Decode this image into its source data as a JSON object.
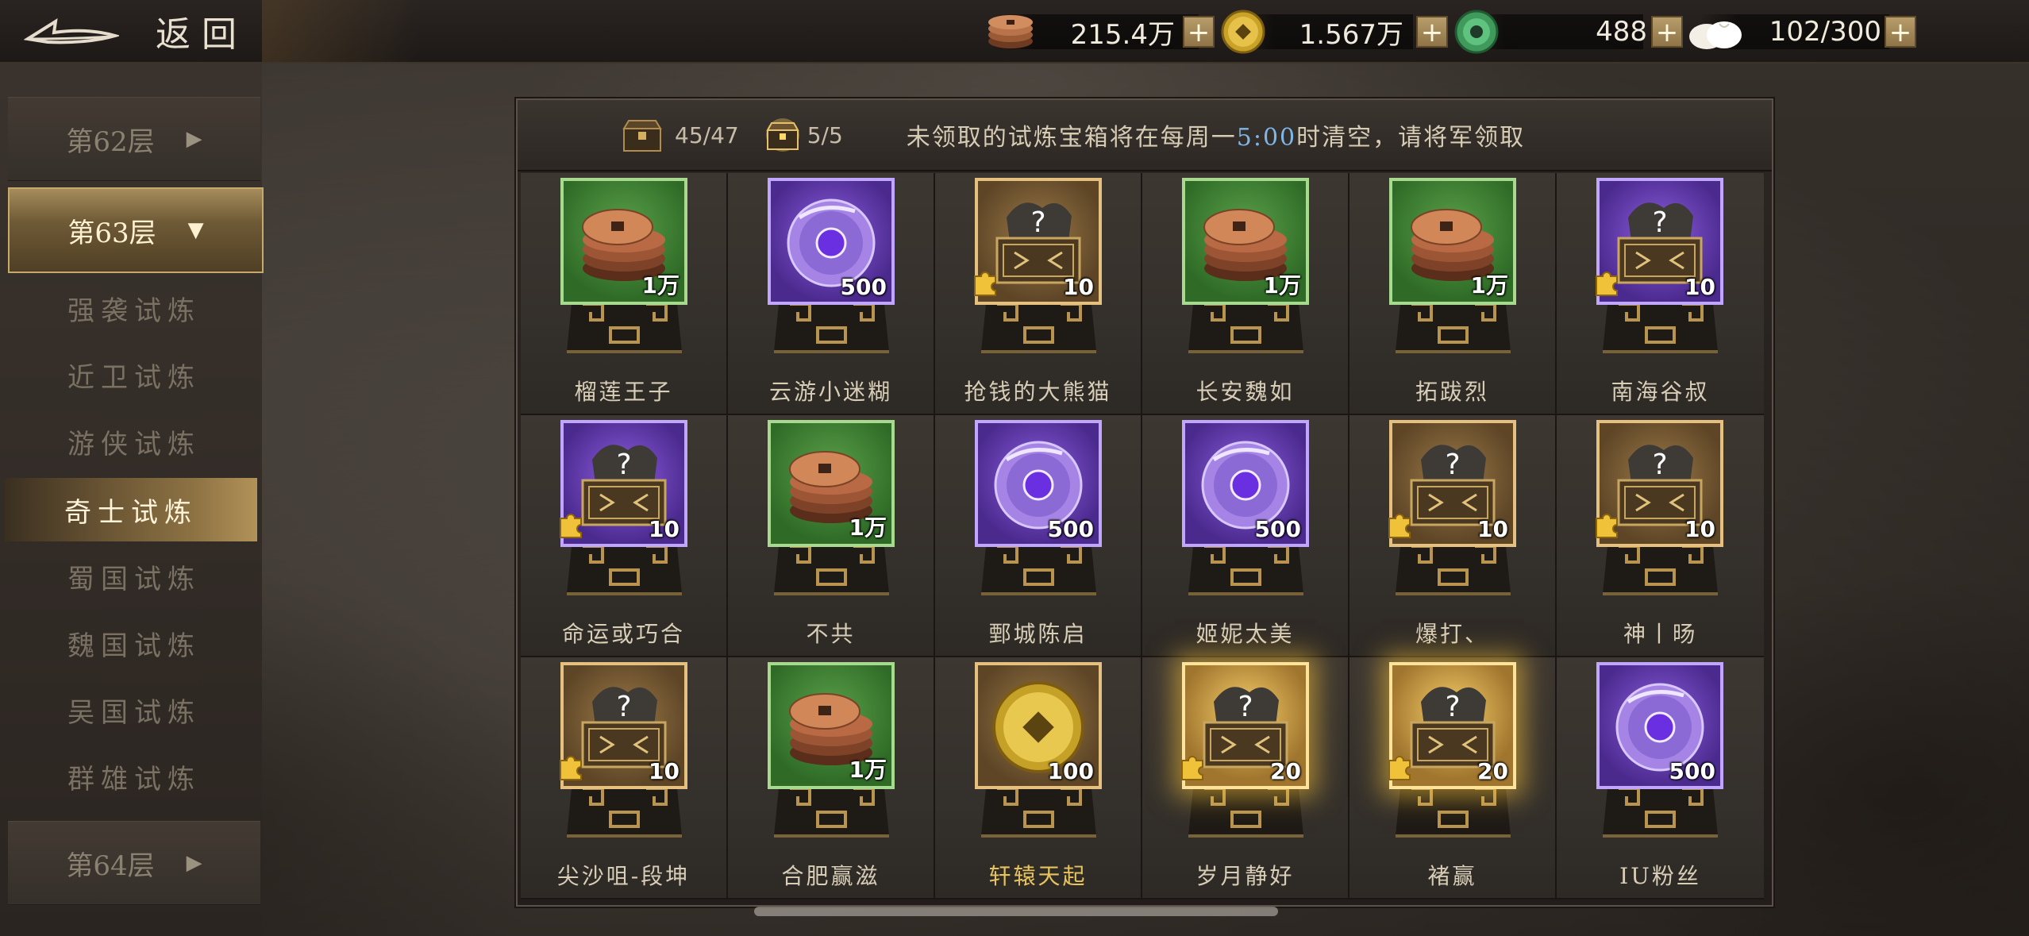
{
  "topbar": {
    "back_label": "返回",
    "resources": [
      {
        "icon": "copper-coins-icon",
        "value": "215.4万"
      },
      {
        "icon": "gold-coin-icon",
        "value": "1.567万"
      },
      {
        "icon": "jade-icon",
        "value": "488"
      },
      {
        "icon": "steamed-bun-icon",
        "value": "102/300"
      }
    ],
    "plus": "+"
  },
  "sidebar": {
    "floors": [
      {
        "label": "第62层",
        "arrow": "▶"
      },
      {
        "label": "第63层",
        "arrow": "▼"
      },
      {
        "label": "第64层",
        "arrow": "▶"
      }
    ],
    "trials": [
      "强袭试炼",
      "近卫试炼",
      "游侠试炼",
      "奇士试炼",
      "蜀国试炼",
      "魏国试炼",
      "吴国试炼",
      "群雄试炼"
    ],
    "selected_trial": "奇士试炼"
  },
  "panel": {
    "chest_count_1": "45/47",
    "chest_count_2": "5/5",
    "notice_before": "未领取的试炼宝箱将在每周一",
    "notice_time": "5:00",
    "notice_after": "时清空，请将军领取"
  },
  "rewards": [
    {
      "type": "coins",
      "frame": "green",
      "count": "1万",
      "name": "榴莲王子"
    },
    {
      "type": "jade-disc",
      "frame": "purple",
      "count": "500",
      "name": "云游小迷糊"
    },
    {
      "type": "chest",
      "frame": "gold",
      "count": "10",
      "name": "抢钱的大熊猫"
    },
    {
      "type": "coins",
      "frame": "green",
      "count": "1万",
      "name": "长安魏如"
    },
    {
      "type": "coins",
      "frame": "green",
      "count": "1万",
      "name": "拓跋烈"
    },
    {
      "type": "chest",
      "frame": "purple",
      "count": "10",
      "name": "南海谷叔"
    },
    {
      "type": "chest",
      "frame": "purple",
      "count": "10",
      "name": "命运或巧合"
    },
    {
      "type": "coins",
      "frame": "green",
      "count": "1万",
      "name": "不共"
    },
    {
      "type": "jade-disc",
      "frame": "purple",
      "count": "500",
      "name": "鄄城陈启"
    },
    {
      "type": "jade-disc",
      "frame": "purple",
      "count": "500",
      "name": "姬妮太美"
    },
    {
      "type": "chest",
      "frame": "gold",
      "count": "10",
      "name": "爆打、"
    },
    {
      "type": "chest",
      "frame": "gold",
      "count": "10",
      "name": "神丨旸"
    },
    {
      "type": "chest",
      "frame": "gold",
      "count": "10",
      "name": "尖沙咀-段坤"
    },
    {
      "type": "coins",
      "frame": "green",
      "count": "1万",
      "name": "合肥赢滋"
    },
    {
      "type": "gold-coin",
      "frame": "gold",
      "count": "100",
      "name": "轩辕天起",
      "highlight": true
    },
    {
      "type": "chest",
      "frame": "glow",
      "count": "20",
      "name": "岁月静好"
    },
    {
      "type": "chest",
      "frame": "glow",
      "count": "20",
      "name": "褚赢"
    },
    {
      "type": "jade-disc",
      "frame": "purple",
      "count": "500",
      "name": "IU粉丝"
    }
  ]
}
